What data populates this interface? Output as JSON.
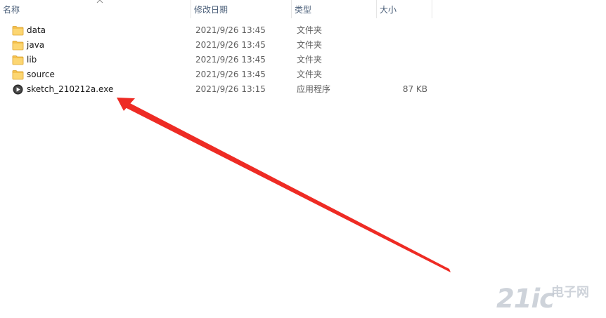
{
  "columns": {
    "name": "名称",
    "date": "修改日期",
    "type": "类型",
    "size": "大小"
  },
  "files": [
    {
      "name": "data",
      "date": "2021/9/26 13:45",
      "type": "文件夹",
      "size": "",
      "icon": "folder-icon"
    },
    {
      "name": "java",
      "date": "2021/9/26 13:45",
      "type": "文件夹",
      "size": "",
      "icon": "folder-icon"
    },
    {
      "name": "lib",
      "date": "2021/9/26 13:45",
      "type": "文件夹",
      "size": "",
      "icon": "folder-icon"
    },
    {
      "name": "source",
      "date": "2021/9/26 13:45",
      "type": "文件夹",
      "size": "",
      "icon": "folder-icon"
    },
    {
      "name": "sketch_210212a.exe",
      "date": "2021/9/26 13:15",
      "type": "应用程序",
      "size": "87 KB",
      "icon": "play-app-icon"
    }
  ],
  "annotation": {
    "color": "#ee2b24",
    "target": "sketch_210212a.exe"
  },
  "watermark": {
    "left": "21ic",
    "right": "电子网"
  },
  "colors": {
    "folder": "#f4c04e",
    "folder_dark": "#d9a12c",
    "header_text": "#4c607a"
  }
}
